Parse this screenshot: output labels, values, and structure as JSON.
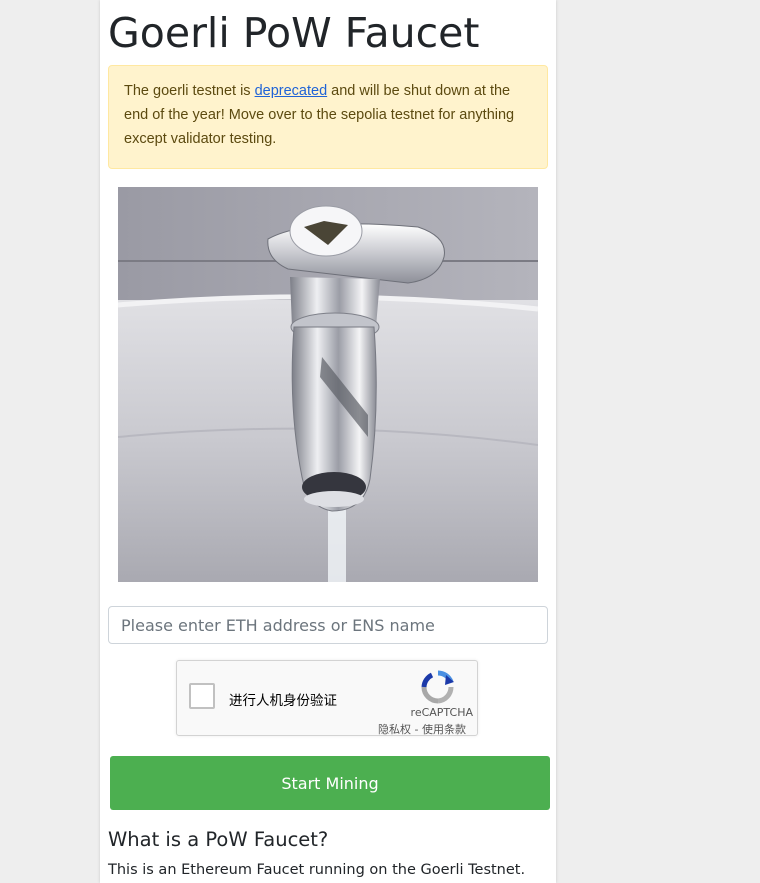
{
  "page": {
    "title": "Goerli PoW Faucet"
  },
  "alert": {
    "text_before": "The goerli testnet is ",
    "link_text": "deprecated",
    "text_after": " and will be shut down at the end of the year! Move over to the sepolia testnet for anything except validator testing."
  },
  "hero_image": {
    "icon": "faucet-photo-with-ethereum-logo"
  },
  "address_input": {
    "placeholder": "Please enter ETH address or ENS name",
    "value": ""
  },
  "captcha": {
    "label": "进行人机身份验证",
    "brand": "reCAPTCHA",
    "privacy_link": "隐私权",
    "separator": " - ",
    "terms_link": "使用条款"
  },
  "start_button": {
    "label": "Start Mining"
  },
  "info": {
    "heading": "What is a PoW Faucet?",
    "text": "This is an Ethereum Faucet running on the Goerli Testnet."
  },
  "colors": {
    "alert_background": "#fff3cd",
    "button": "#4caf50",
    "link": "#1f63d6"
  }
}
